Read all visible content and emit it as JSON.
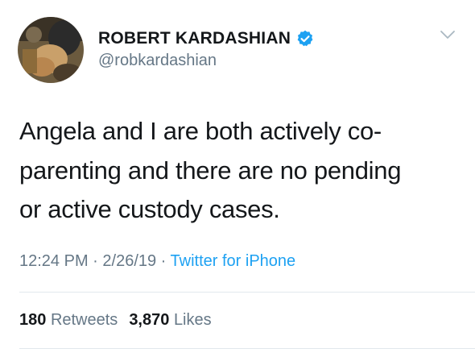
{
  "author": {
    "display_name": "ROBERT KARDASHIAN",
    "handle": "@robkardashian",
    "verified_icon": "verified-badge-icon",
    "avatar_icon": "avatar-photo"
  },
  "tweet": {
    "text": "Angela and I are both actively co-parenting and there are no pending or active custody cases.",
    "lines": [
      "Angela and I are both actively co-",
      "parenting and there are no pending",
      "or active custody cases."
    ]
  },
  "meta": {
    "time": "12:24 PM",
    "separator1": " · ",
    "date": "2/26/19",
    "separator2": " · ",
    "source": "Twitter for iPhone"
  },
  "stats": {
    "retweets_count": "180",
    "retweets_label": "Retweets",
    "likes_count": "3,870",
    "likes_label": "Likes"
  },
  "colors": {
    "text_primary": "#14171a",
    "text_secondary": "#657786",
    "accent": "#1da1f2",
    "divider": "#e1e8ed"
  },
  "icons": {
    "menu": "chevron-down-icon"
  }
}
